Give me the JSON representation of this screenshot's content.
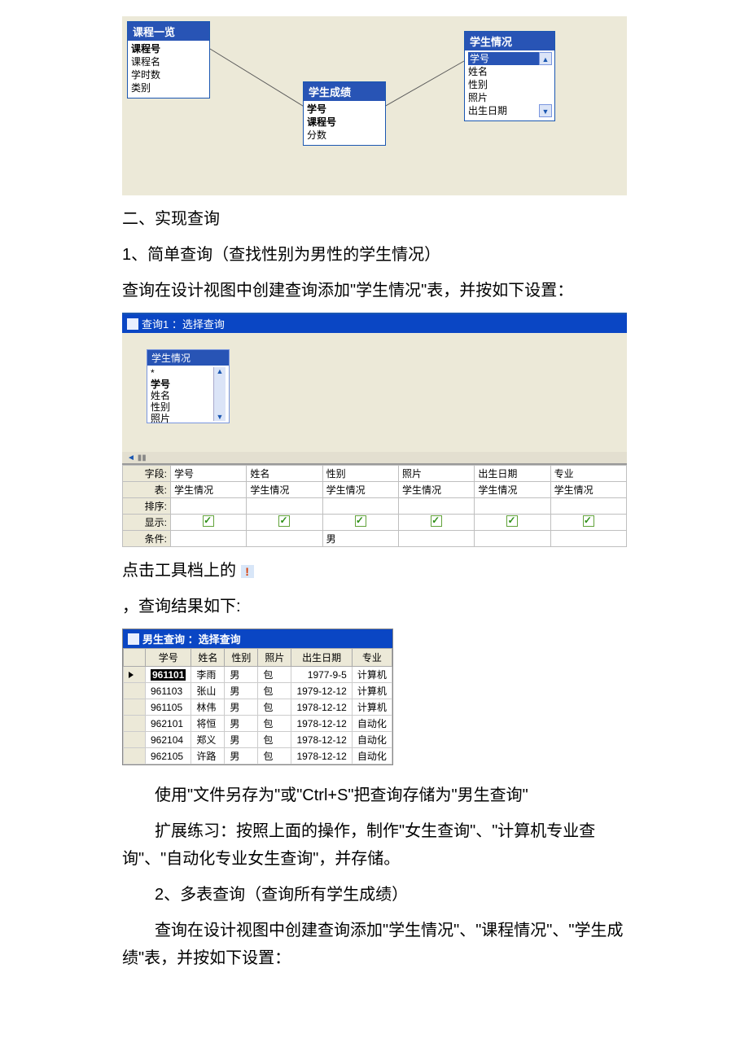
{
  "diagram": {
    "tables": {
      "courses": {
        "title": "课程一览",
        "fields": [
          "课程号",
          "课程名",
          "学时数",
          "类别"
        ],
        "bold": [
          "课程号"
        ]
      },
      "scores": {
        "title": "学生成绩",
        "fields": [
          "学号",
          "课程号",
          "分数"
        ],
        "bold": [
          "学号",
          "课程号"
        ]
      },
      "students": {
        "title": "学生情况",
        "fields": [
          "学号",
          "姓名",
          "性别",
          "照片",
          "出生日期"
        ],
        "bold": [
          "学号"
        ],
        "selected": "学号"
      }
    }
  },
  "text": {
    "section2": "二、实现查询",
    "p1": "1、简单查询（查找性别为男性的学生情况）",
    "p2": "查询在设计视图中创建查询添加\"学生情况\"表，并按如下设置：",
    "qd1_title": "查询1 ：选择查询",
    "p3": "点击工具档上的",
    "p4": "，查询结果如下:",
    "p5": "使用\"文件另存为\"或\"Ctrl+S\"把查询存储为\"男生查询\"",
    "p6": "扩展练习：按照上面的操作，制作\"女生查询\"、\"计算机专业查询\"、\"自动化专业女生查询\"，并存储。",
    "p7": "2、多表查询（查询所有学生成绩）",
    "p8": "查询在设计视图中创建查询添加\"学生情况\"、\"课程情况\"、\"学生成绩\"表，并按如下设置："
  },
  "qdesign": {
    "tablebox": {
      "title": "学生情况",
      "fields": [
        "*",
        "学号",
        "姓名",
        "性别",
        "照片"
      ]
    },
    "rows": {
      "field": "字段:",
      "table": "表:",
      "sort": "排序:",
      "show": "显示:",
      "cond": "条件:"
    },
    "cols": [
      {
        "field": "学号",
        "table": "学生情况",
        "show": true,
        "cond": ""
      },
      {
        "field": "姓名",
        "table": "学生情况",
        "show": true,
        "cond": ""
      },
      {
        "field": "性别",
        "table": "学生情况",
        "show": true,
        "cond": "男"
      },
      {
        "field": "照片",
        "table": "学生情况",
        "show": true,
        "cond": ""
      },
      {
        "field": "出生日期",
        "table": "学生情况",
        "show": true,
        "cond": ""
      },
      {
        "field": "专业",
        "table": "学生情况",
        "show": true,
        "cond": ""
      }
    ]
  },
  "result": {
    "title": "男生查询 ：选择查询",
    "headers": [
      "学号",
      "姓名",
      "性别",
      "照片",
      "出生日期",
      "专业"
    ],
    "rows": [
      [
        "961101",
        "李雨",
        "男",
        "包",
        "1977-9-5",
        "计算机"
      ],
      [
        "961103",
        "张山",
        "男",
        "包",
        "1979-12-12",
        "计算机"
      ],
      [
        "961105",
        "林伟",
        "男",
        "包",
        "1978-12-12",
        "计算机"
      ],
      [
        "962101",
        "将恒",
        "男",
        "包",
        "1978-12-12",
        "自动化"
      ],
      [
        "962104",
        "郑义",
        "男",
        "包",
        "1978-12-12",
        "自动化"
      ],
      [
        "962105",
        "许路",
        "男",
        "包",
        "1978-12-12",
        "自动化"
      ]
    ]
  }
}
